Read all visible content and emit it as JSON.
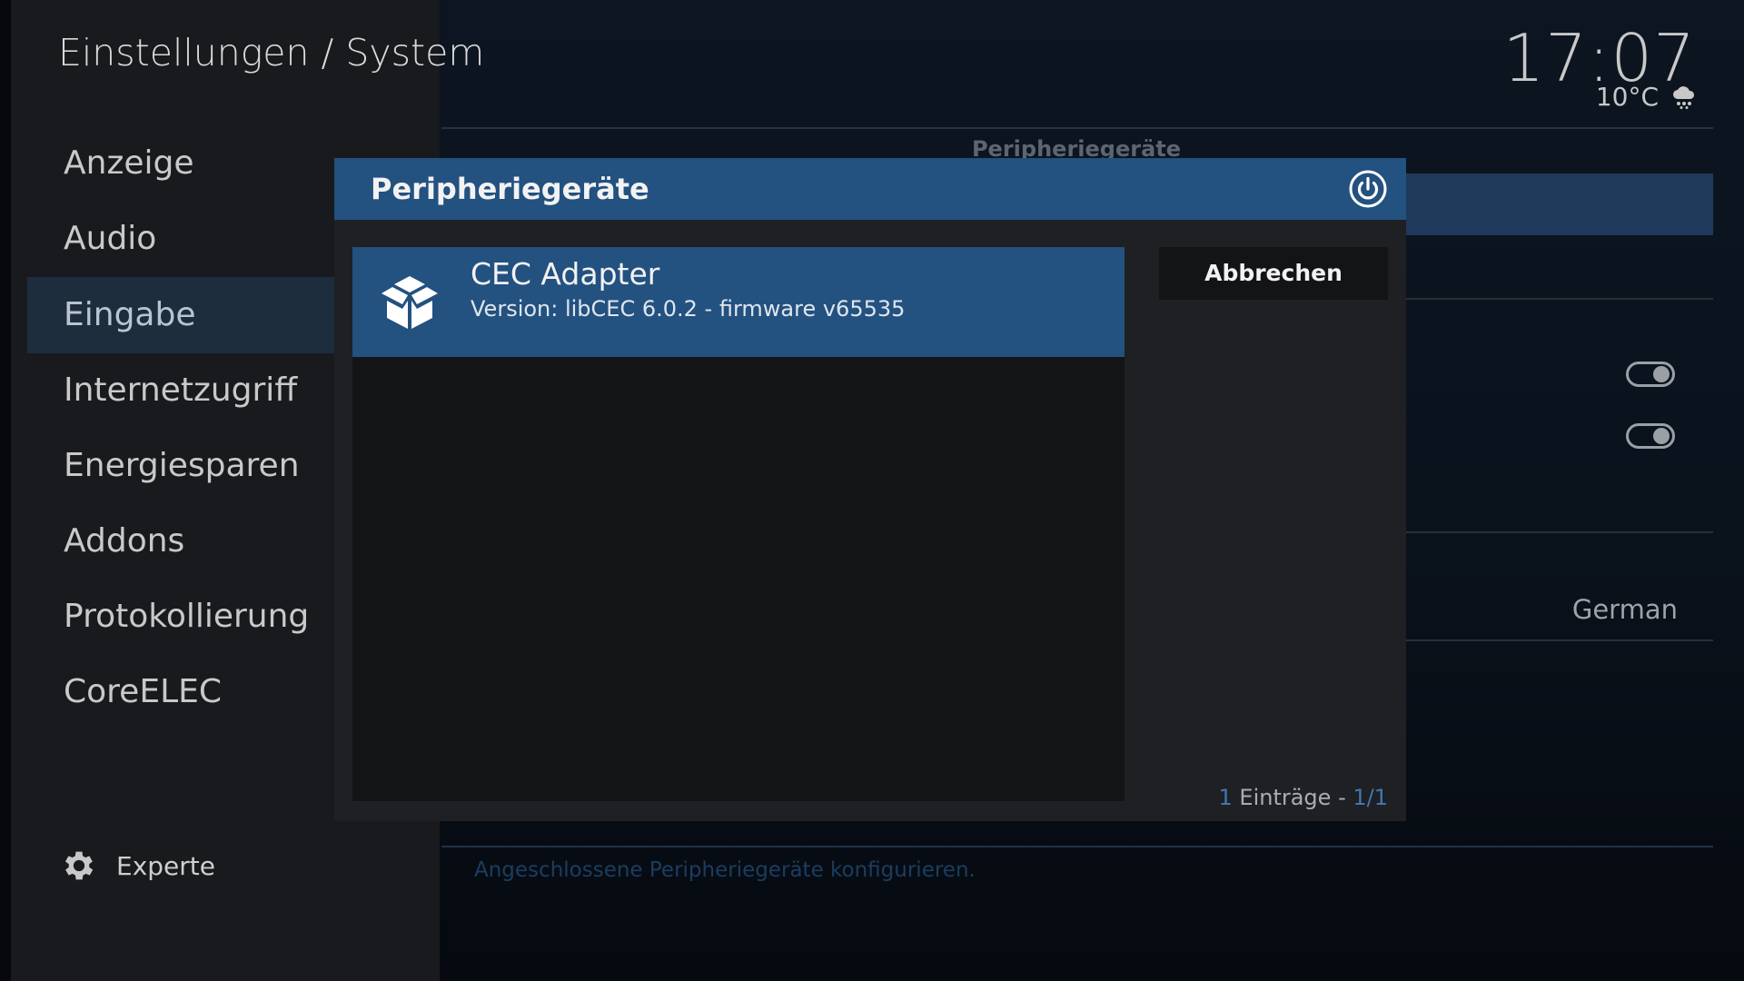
{
  "header": {
    "title": "Einstellungen / System",
    "clock": "17:07",
    "temperature": "10°C",
    "weather_icon": "cloud-snow-icon"
  },
  "sidebar": {
    "items": [
      {
        "label": "Anzeige",
        "active": false
      },
      {
        "label": "Audio",
        "active": false
      },
      {
        "label": "Eingabe",
        "active": true
      },
      {
        "label": "Internetzugriff",
        "active": false
      },
      {
        "label": "Energiesparen",
        "active": false
      },
      {
        "label": "Addons",
        "active": false
      },
      {
        "label": "Protokollierung",
        "active": false
      },
      {
        "label": "CoreELEC",
        "active": false
      }
    ],
    "level_label": "Experte",
    "level_icon": "gear-icon"
  },
  "background": {
    "section_heading": "Peripheriegeräte",
    "language_value": "German",
    "description": "Angeschlossene Peripheriegeräte konfigurieren.",
    "toggles": [
      true,
      true
    ]
  },
  "dialog": {
    "title": "Peripheriegeräte",
    "header_icon": "power-icon",
    "items": [
      {
        "icon": "open-box-icon",
        "title": "CEC Adapter",
        "subtitle": "Version: libCEC 6.0.2 - firmware v65535"
      }
    ],
    "cancel_label": "Abbrechen",
    "entries": {
      "count": "1",
      "text": "Einträge -",
      "page": "1/1"
    }
  },
  "colors": {
    "accent": "#235180",
    "dialog_bg": "#1e2023",
    "list_bg": "#131416",
    "sidebar_bg": "#181a1d",
    "sidebar_active": "#1e2d3d",
    "counter_blue": "#3e78b4"
  }
}
